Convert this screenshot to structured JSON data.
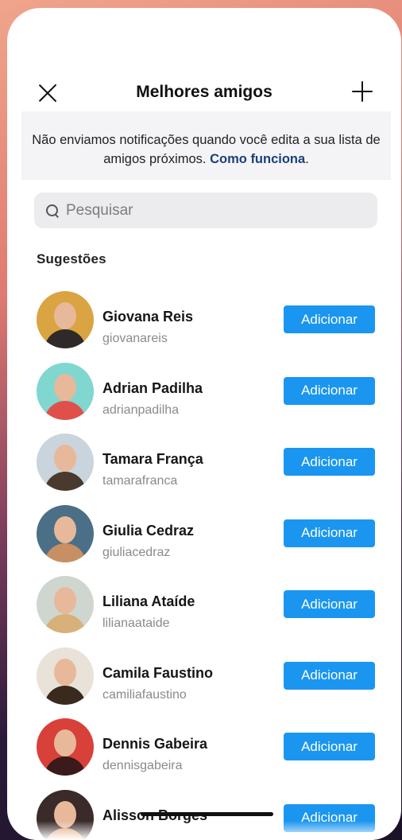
{
  "header": {
    "title": "Melhores amigos"
  },
  "notice": {
    "text": "Não enviamos notificações quando você edita a sua lista de amigos próximos.",
    "link": "Como funciona"
  },
  "search": {
    "placeholder": "Pesquisar"
  },
  "suggestions": {
    "title": "Sugestões",
    "button_label": "Adicionar",
    "users": [
      {
        "name": "Giovana Reis",
        "username": "giovanareis",
        "avatar_bg": "#d9a441",
        "avatar_accent": "#2f2a2a"
      },
      {
        "name": "Adrian Padilha",
        "username": "adrianpadilha",
        "avatar_bg": "#7fd7d0",
        "avatar_accent": "#e0504a"
      },
      {
        "name": "Tamara França",
        "username": "tamarafranca",
        "avatar_bg": "#c9d4dc",
        "avatar_accent": "#4a3a2e"
      },
      {
        "name": "Giulia Cedraz",
        "username": "giuliacedraz",
        "avatar_bg": "#4a6f86",
        "avatar_accent": "#c98f64"
      },
      {
        "name": "Liliana Ataíde",
        "username": "lilianaataide",
        "avatar_bg": "#cfd6d0",
        "avatar_accent": "#d8b07a"
      },
      {
        "name": "Camila Faustino",
        "username": "camiliafaustino",
        "avatar_bg": "#e8e2d8",
        "avatar_accent": "#3a2a1e"
      },
      {
        "name": "Dennis Gabeira",
        "username": "dennisgabeira",
        "avatar_bg": "#d8403a",
        "avatar_accent": "#3a1a1a"
      },
      {
        "name": "Alisson Borges",
        "username": "",
        "avatar_bg": "#3a2a2a",
        "avatar_accent": "#e0a070"
      }
    ]
  },
  "colors": {
    "accent": "#1a96f0",
    "link": "#1b3f7a"
  }
}
